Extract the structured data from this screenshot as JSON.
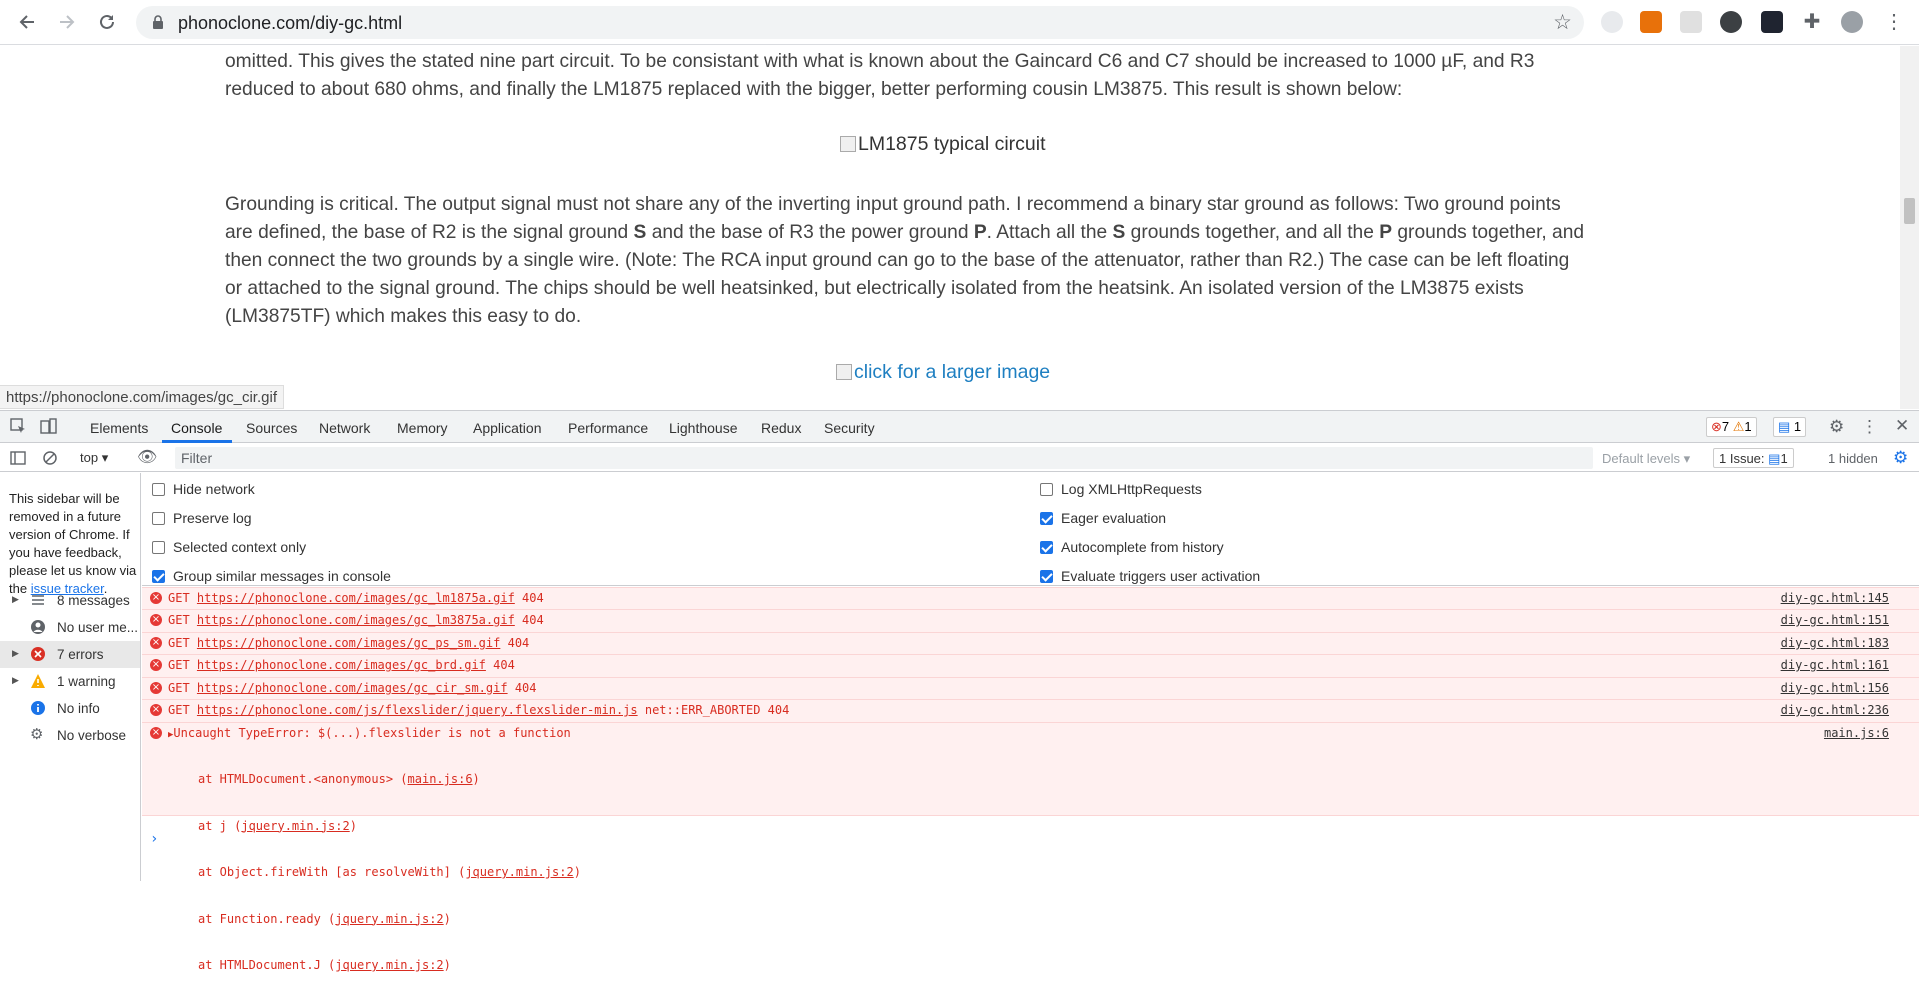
{
  "browser": {
    "url": "phonoclone.com/diy-gc.html",
    "status_url": "https://phonoclone.com/images/gc_cir.gif"
  },
  "page": {
    "para1_line1": "omitted. This gives the stated nine part circuit. To be consistant with what is known about the Gaincard C6 and C7 should be increased to 1000 µF, and R3",
    "para1_line2": "reduced to about 680 ohms, and finally the LM1875 replaced with the bigger, better performing cousin LM3875. This result is shown below:",
    "image1_alt": "LM1875 typical circuit",
    "para2": [
      "Grounding is critical. The output signal must not share any of the inverting input ground path. I recommend a binary star ground as follows: Two ground points",
      "are defined, the base of R2 is the signal ground ",
      "S",
      " and the base of R3 the power ground ",
      "P",
      ". Attach all the ",
      "S",
      " grounds together, and all the ",
      "P",
      " grounds together, and",
      "then connect the two grounds by a single wire. (Note: The RCA input ground can go to the base of the attenuator, rather than R2.) The case can be left floating",
      "or attached to the signal ground. The chips should be well heatsinked, but electrically isolated from the heatsink. An isolated version of the LM3875 exists",
      "(LM3875TF) which makes this easy to do."
    ],
    "image2_alt": "click for a larger image"
  },
  "devtools": {
    "tabs": [
      "Elements",
      "Console",
      "Sources",
      "Network",
      "Memory",
      "Application",
      "Performance",
      "Lighthouse",
      "Redux",
      "Security"
    ],
    "error_count": "7",
    "warning_count": "1",
    "info_count": "1",
    "context": "top",
    "filter_placeholder": "Filter",
    "default_levels": "Default levels",
    "issues_label": "1 Issue:",
    "issues_count": "1",
    "hidden": "1 hidden",
    "sidebar_note": "This sidebar will be removed in a future version of Chrome. If you have feedback, please let us know via the",
    "sidebar_link": "issue tracker",
    "sidebar_items": [
      "8 messages",
      "No user me...",
      "7 errors",
      "1 warning",
      "No info",
      "No verbose"
    ],
    "settings_left": [
      "Hide network",
      "Preserve log",
      "Selected context only",
      "Group similar messages in console"
    ],
    "settings_right": [
      "Log XMLHttpRequests",
      "Eager evaluation",
      "Autocomplete from history",
      "Evaluate triggers user activation"
    ],
    "messages": [
      {
        "method": "GET",
        "url": "https://phonoclone.com/images/gc_lm1875a.gif",
        "status": "404",
        "src": "diy-gc.html:145"
      },
      {
        "method": "GET",
        "url": "https://phonoclone.com/images/gc_lm3875a.gif",
        "status": "404",
        "src": "diy-gc.html:151"
      },
      {
        "method": "GET",
        "url": "https://phonoclone.com/images/gc_ps_sm.gif",
        "status": "404",
        "src": "diy-gc.html:183"
      },
      {
        "method": "GET",
        "url": "https://phonoclone.com/images/gc_brd.gif",
        "status": "404",
        "src": "diy-gc.html:161"
      },
      {
        "method": "GET",
        "url": "https://phonoclone.com/images/gc_cir_sm.gif",
        "status": "404",
        "src": "diy-gc.html:156"
      },
      {
        "method": "GET",
        "url": "https://phonoclone.com/js/flexslider/jquery.flexslider-min.js",
        "status": "net::ERR_ABORTED 404",
        "src": "diy-gc.html:236"
      }
    ],
    "exception": {
      "title": "Uncaught TypeError: $(...).flexslider is not a function",
      "src": "main.js:6",
      "stack": [
        {
          "pre": "at HTMLDocument.<anonymous> (",
          "link": "main.js:6",
          "post": ")"
        },
        {
          "pre": "at j (",
          "link": "jquery.min.js:2",
          "post": ")"
        },
        {
          "pre": "at Object.fireWith [as resolveWith] (",
          "link": "jquery.min.js:2",
          "post": ")"
        },
        {
          "pre": "at Function.ready (",
          "link": "jquery.min.js:2",
          "post": ")"
        },
        {
          "pre": "at HTMLDocument.J (",
          "link": "jquery.min.js:2",
          "post": ")"
        }
      ]
    },
    "prompt_glyph": "›"
  }
}
